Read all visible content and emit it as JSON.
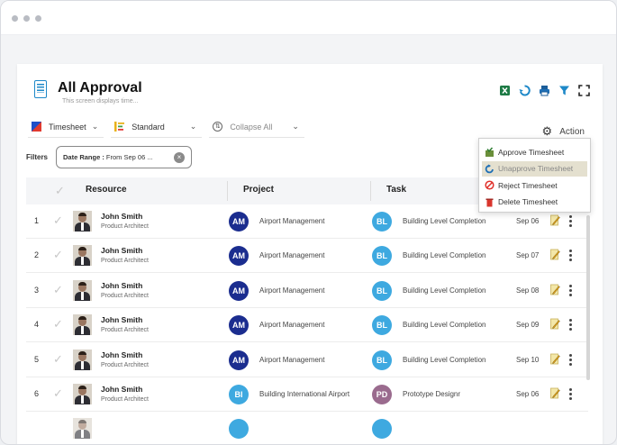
{
  "page": {
    "title": "All Approval",
    "subtitle": "This screen displays time..."
  },
  "toolbar": {
    "icons": [
      "excel-icon",
      "refresh-icon",
      "print-icon",
      "filter-icon",
      "fullscreen-icon"
    ],
    "timesheet_select": "Timesheet",
    "standard_select": "Standard",
    "collapse_label": "Collapse All",
    "action_label": "Action"
  },
  "filters": {
    "label": "Filters",
    "chip_key": "Date Range :",
    "chip_value": " From Sep 06 ..."
  },
  "table": {
    "columns": [
      "Resource",
      "Project",
      "Task"
    ],
    "rows": [
      {
        "n": "1",
        "name": "John Smith",
        "role": "Product Architect",
        "pinit": "AM",
        "pcolor": "#1b2d8f",
        "project": "Airport Management",
        "tinit": "BL",
        "tcolor": "#3ea9e0",
        "task": "Building Level Completion",
        "date": "Sep 06"
      },
      {
        "n": "2",
        "name": "John Smith",
        "role": "Product Architect",
        "pinit": "AM",
        "pcolor": "#1b2d8f",
        "project": "Airport Management",
        "tinit": "BL",
        "tcolor": "#3ea9e0",
        "task": "Building Level Completion",
        "date": "Sep 07"
      },
      {
        "n": "3",
        "name": "John Smith",
        "role": "Product Architect",
        "pinit": "AM",
        "pcolor": "#1b2d8f",
        "project": "Airport Management",
        "tinit": "BL",
        "tcolor": "#3ea9e0",
        "task": "Building Level Completion",
        "date": "Sep 08"
      },
      {
        "n": "4",
        "name": "John Smith",
        "role": "Product Architect",
        "pinit": "AM",
        "pcolor": "#1b2d8f",
        "project": "Airport Management",
        "tinit": "BL",
        "tcolor": "#3ea9e0",
        "task": "Building Level Completion",
        "date": "Sep 09"
      },
      {
        "n": "5",
        "name": "John Smith",
        "role": "Product Architect",
        "pinit": "AM",
        "pcolor": "#1b2d8f",
        "project": "Airport Management",
        "tinit": "BL",
        "tcolor": "#3ea9e0",
        "task": "Building Level Completion",
        "date": "Sep 10"
      },
      {
        "n": "6",
        "name": "John Smith",
        "role": "Product Architect",
        "pinit": "BI",
        "pcolor": "#3ea9e0",
        "project": "Building International Airport",
        "tinit": "PD",
        "tcolor": "#9a6b8e",
        "task": "Prototype Designr",
        "date": "Sep 06"
      },
      {
        "n": "",
        "name": "",
        "role": "",
        "pinit": "",
        "pcolor": "#3ea9e0",
        "project": "",
        "tinit": "",
        "tcolor": "#3ea9e0",
        "task": "",
        "date": ""
      }
    ]
  },
  "action_menu": {
    "items": [
      {
        "label": "Approve Timesheet",
        "icon": "approve-icon"
      },
      {
        "label": "Unapprove Timesheet",
        "icon": "unapprove-icon",
        "highlighted": true
      },
      {
        "label": "Reject Timesheet",
        "icon": "reject-icon"
      },
      {
        "label": "Delete Timesheet",
        "icon": "delete-icon"
      }
    ]
  },
  "colors": {
    "accent": "#1e88c8",
    "am_badge": "#1b2d8f",
    "bl_badge": "#3ea9e0",
    "pd_badge": "#9a6b8e",
    "menu_highlight": "#e4e0cf"
  }
}
